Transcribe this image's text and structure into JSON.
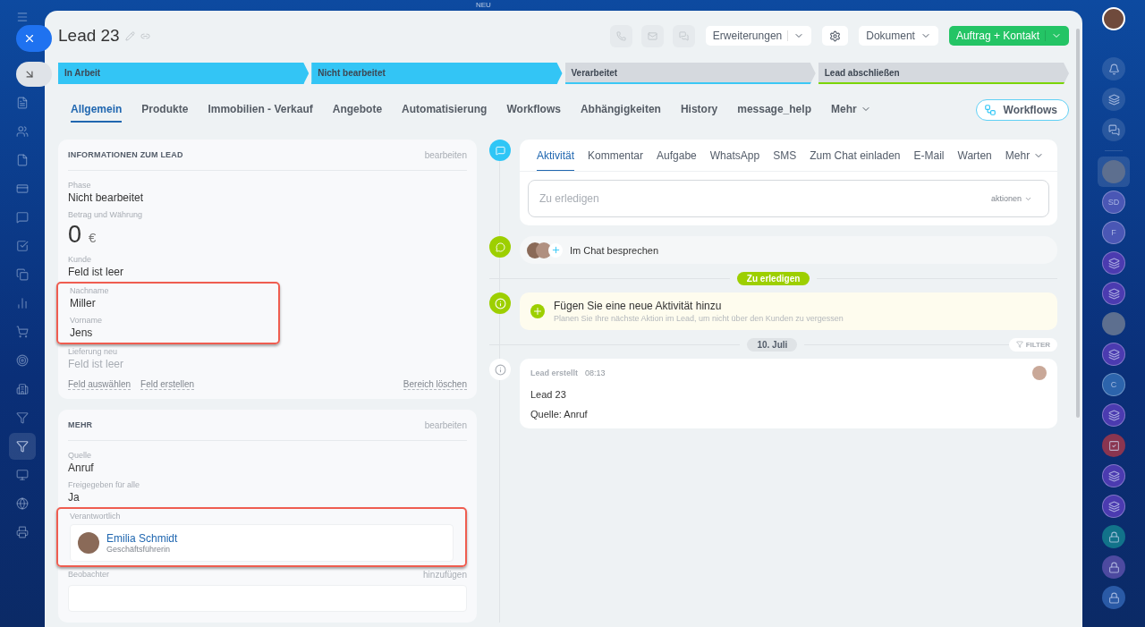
{
  "top_badge": "NEU",
  "left_nav": [
    {
      "selected": false
    },
    {
      "selected": false
    },
    {
      "selected": false
    },
    {
      "selected": false
    },
    {
      "selected": false
    },
    {
      "selected": false
    },
    {
      "selected": false
    },
    {
      "selected": false
    },
    {
      "selected": false
    },
    {
      "selected": false
    },
    {
      "selected": false
    },
    {
      "selected": false
    },
    {
      "selected": true
    },
    {
      "selected": false
    },
    {
      "selected": false
    },
    {
      "selected": false
    }
  ],
  "header": {
    "title": "Lead 23",
    "extensions_button": "Erweiterungen",
    "document_button": "Dokument",
    "primary_button": "Auftrag + Kontakt"
  },
  "stages": [
    {
      "label": "In Arbeit",
      "reached": true,
      "color": "#33c5f5"
    },
    {
      "label": "Nicht bearbeitet",
      "reached": true,
      "color": "#33c5f5"
    },
    {
      "label": "Verarbeitet",
      "reached": false,
      "color": "#3bc8f5"
    },
    {
      "label": "Lead abschließen",
      "reached": false,
      "color": "#7bd500"
    }
  ],
  "tabs": [
    {
      "label": "Allgemein",
      "selected": true,
      "kind": "tab"
    },
    {
      "label": "Produkte",
      "selected": false,
      "kind": "tab"
    },
    {
      "label": "Immobilien - Verkauf",
      "selected": false,
      "kind": "tab"
    },
    {
      "label": "Angebote",
      "selected": false,
      "kind": "tab"
    },
    {
      "label": "Automatisierung",
      "selected": false,
      "kind": "tab"
    },
    {
      "label": "Workflows",
      "selected": false,
      "kind": "tab"
    },
    {
      "label": "Abhängigkeiten",
      "selected": false,
      "kind": "tab"
    },
    {
      "label": "History",
      "selected": false,
      "kind": "tab"
    },
    {
      "label": "message_help",
      "selected": false,
      "kind": "tab"
    },
    {
      "label": "Mehr",
      "selected": false,
      "kind": "dropdown"
    }
  ],
  "workflows_button": "Workflows",
  "cards": [
    {
      "title": "INFORMATIONEN ZUM LEAD",
      "action": "bearbeiten",
      "fields": [
        {
          "label": "Phase",
          "kind": "text",
          "value": "Nicht bearbeitet",
          "highlighted": false
        },
        {
          "label": "Betrag und Währung",
          "kind": "money",
          "value": "0",
          "currency": "€",
          "highlighted": false
        },
        {
          "label": "Kunde",
          "kind": "text",
          "value": "Feld ist leer",
          "highlighted": false
        },
        {
          "label": "Nachname",
          "kind": "text",
          "value": "Miller",
          "highlighted": true
        },
        {
          "label": "Vorname",
          "kind": "text",
          "value": "Jens",
          "highlighted": true
        },
        {
          "label": "Lieferung neu",
          "kind": "empty",
          "value": "Feld ist leer",
          "highlighted": false
        }
      ],
      "footer_links": [
        "Feld auswählen",
        "Feld erstellen"
      ],
      "footer_right": "Bereich löschen"
    },
    {
      "title": "MEHR",
      "action": "bearbeiten",
      "fields": [
        {
          "label": "Quelle",
          "kind": "text",
          "value": "Anruf",
          "highlighted": false
        },
        {
          "label": "Freigegeben für alle",
          "kind": "text",
          "value": "Ja",
          "highlighted": false
        },
        {
          "label": "Verantwortlich",
          "kind": "person",
          "name": "Emilia Schmidt",
          "role": "Geschäftsführerin",
          "highlighted": true
        },
        {
          "label": "Beobachter",
          "kind": "add",
          "action": "hinzufügen",
          "highlighted": false
        }
      ]
    }
  ],
  "composer": {
    "tabs": [
      {
        "label": "Aktivität",
        "selected": true,
        "kind": "tab"
      },
      {
        "label": "Kommentar",
        "selected": false,
        "kind": "tab"
      },
      {
        "label": "Aufgabe",
        "selected": false,
        "kind": "tab"
      },
      {
        "label": "WhatsApp",
        "selected": false,
        "kind": "tab"
      },
      {
        "label": "SMS",
        "selected": false,
        "kind": "tab"
      },
      {
        "label": "Zum Chat einladen",
        "selected": false,
        "kind": "tab"
      },
      {
        "label": "E-Mail",
        "selected": false,
        "kind": "tab"
      },
      {
        "label": "Warten",
        "selected": false,
        "kind": "tab"
      },
      {
        "label": "Mehr",
        "selected": false,
        "kind": "dropdown"
      }
    ],
    "placeholder": "Zu erledigen",
    "actions": "aktionen"
  },
  "chat_row": "Im Chat besprechen",
  "todo_badge": "Zu erledigen",
  "suggestion": {
    "title": "Fügen Sie eine neue Aktivität hinzu",
    "subtitle": "Planen Sie Ihre nächste Aktion im Lead, um nicht über den Kunden zu vergessen"
  },
  "date_badge": "10. Juli",
  "filter_button": "FILTER",
  "events": [
    {
      "title": "Lead erstellt",
      "time": "08:13",
      "lines": [
        "Lead 23",
        "Quelle: Anruf"
      ]
    }
  ],
  "right_bar": [
    {
      "kind": "avatar",
      "selected": true
    },
    {
      "kind": "letters",
      "text": "SD",
      "color": "#4a57b5",
      "selected": false
    },
    {
      "kind": "letters",
      "text": "F",
      "color": "#4a57b5",
      "selected": false
    },
    {
      "kind": "logo",
      "color": "#4b3bb0",
      "selected": false
    },
    {
      "kind": "logo",
      "color": "#4b3bb0",
      "selected": false
    },
    {
      "kind": "avatar",
      "selected": false
    },
    {
      "kind": "logo",
      "color": "#4b3bb0",
      "selected": false
    },
    {
      "kind": "letters",
      "text": "C",
      "color": "#2c64ac",
      "selected": false
    },
    {
      "kind": "logo",
      "color": "#4b3bb0",
      "selected": false
    },
    {
      "kind": "task",
      "color": "#8a3550",
      "selected": false
    },
    {
      "kind": "logo",
      "color": "#4b3bb0",
      "selected": false
    },
    {
      "kind": "logo",
      "color": "#4b3bb0",
      "selected": false
    },
    {
      "kind": "lock",
      "color": "#12738a",
      "selected": false
    },
    {
      "kind": "lock",
      "color": "#4d4aa0",
      "selected": false
    },
    {
      "kind": "lock",
      "color": "#2a5aa6",
      "selected": false
    }
  ]
}
